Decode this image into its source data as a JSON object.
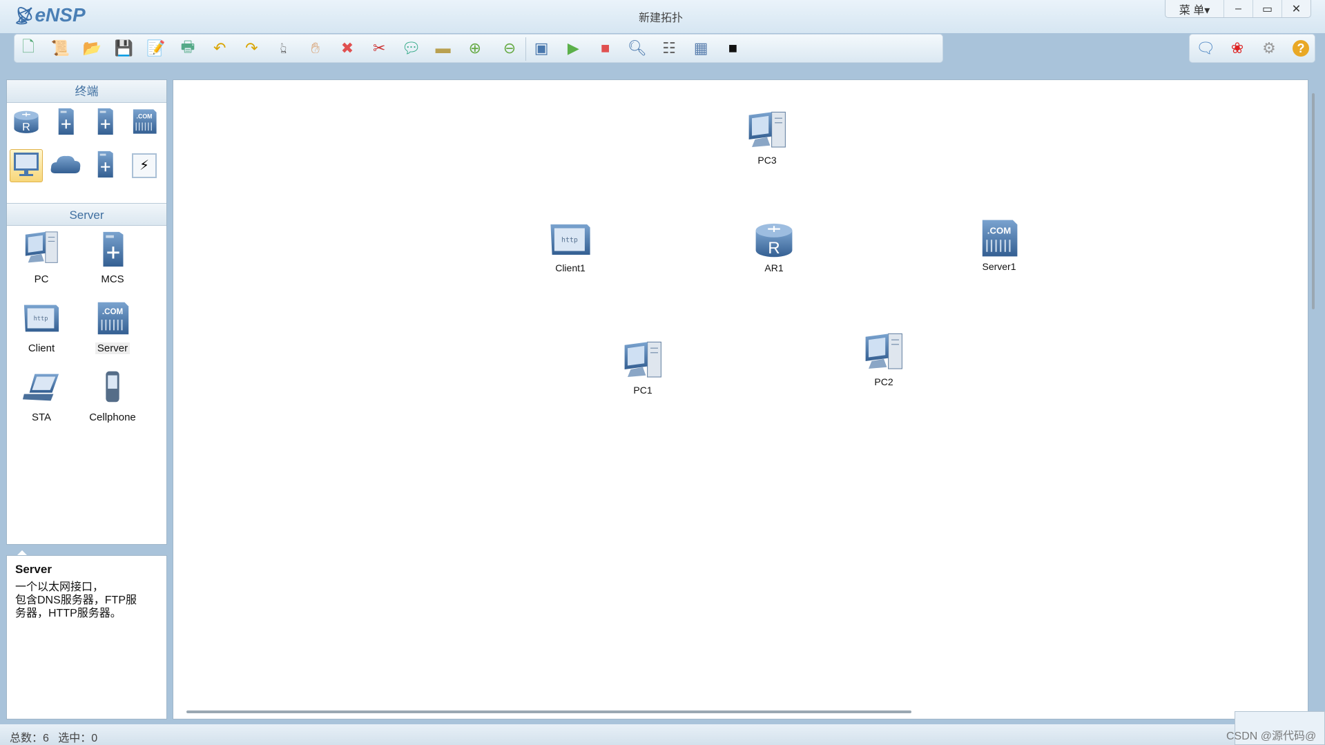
{
  "app": {
    "name": "eNSP",
    "window_title": "新建拓扑",
    "menu_label": "菜 单▾"
  },
  "toolbar": {
    "items": [
      "new-topology",
      "new-example",
      "open",
      "save",
      "save-as",
      "print",
      "undo",
      "redo",
      "select",
      "pan",
      "delete",
      "delete-link",
      "text",
      "palette",
      "zoom-in",
      "zoom-out",
      "fit",
      "start-device",
      "stop-device",
      "capture",
      "topology",
      "grid",
      "cli"
    ],
    "right_items": [
      "feedback",
      "huawei",
      "settings",
      "help"
    ]
  },
  "left_panel": {
    "category_header": "终端",
    "category_icons": [
      "router",
      "switch",
      "wlan",
      "firewall",
      "terminal",
      "cloud",
      "other-device",
      "custom-link"
    ],
    "selected_category": "terminal",
    "sub_header": "Server",
    "devices": [
      {
        "label": "PC",
        "icon": "pc"
      },
      {
        "label": "MCS",
        "icon": "mcs"
      },
      {
        "label": "Client",
        "icon": "client"
      },
      {
        "label": "Server",
        "icon": "server"
      },
      {
        "label": "STA",
        "icon": "laptop"
      },
      {
        "label": "Cellphone",
        "icon": "cellphone"
      }
    ],
    "selected_device": "Server"
  },
  "description": {
    "title": "Server",
    "lines": [
      "一个以太网接口，",
      "包含DNS服务器，FTP服",
      "务器，HTTP服务器。"
    ]
  },
  "canvas": {
    "nodes": [
      {
        "label": "PC3",
        "icon": "pc"
      },
      {
        "label": "Client1",
        "icon": "client"
      },
      {
        "label": "AR1",
        "icon": "router"
      },
      {
        "label": "Server1",
        "icon": "server"
      },
      {
        "label": "PC1",
        "icon": "pc"
      },
      {
        "label": "PC2",
        "icon": "pc"
      }
    ]
  },
  "status": {
    "total_label": "总数：",
    "total": "6",
    "selected_label": "选中：",
    "selected": "0"
  },
  "watermark": "CSDN @源代码@",
  "colors": {
    "accent": "#3f6fa0",
    "selected": "#f8d77a",
    "device": "#4a78ad"
  }
}
